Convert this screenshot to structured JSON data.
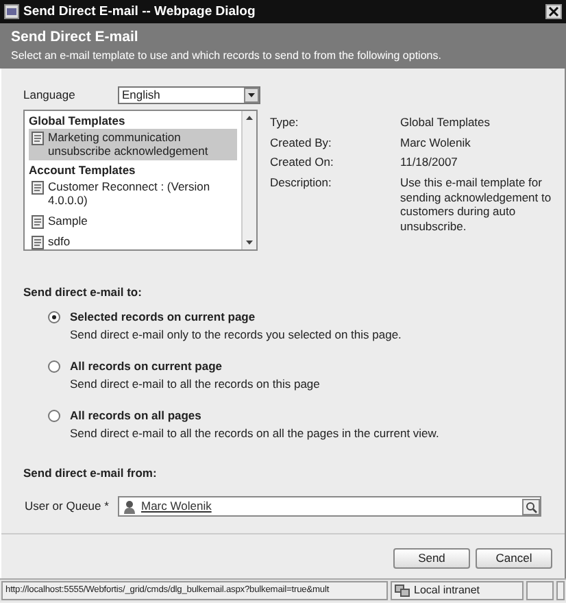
{
  "window": {
    "title": "Send Direct E-mail -- Webpage Dialog"
  },
  "header": {
    "title": "Send Direct E-mail",
    "subtitle": "Select an e-mail template to use and which records to send to from the following options."
  },
  "language": {
    "label": "Language",
    "value": "English"
  },
  "templates": {
    "groups": [
      {
        "name": "Global Templates",
        "items": [
          {
            "name": "Marketing communication unsubscribe acknowledgement",
            "selected": true
          }
        ]
      },
      {
        "name": "Account Templates",
        "items": [
          {
            "name": "Customer Reconnect : (Version 4.0.0.0)",
            "selected": false
          },
          {
            "name": "Sample",
            "selected": false
          },
          {
            "name": "sdfo",
            "selected": false
          }
        ]
      }
    ]
  },
  "details": [
    {
      "label": "Type:",
      "value": "Global Templates"
    },
    {
      "label": "Created By:",
      "value": "Marc Wolenik"
    },
    {
      "label": "Created On:",
      "value": "11/18/2007"
    },
    {
      "label": "Description:",
      "value": "Use this e-mail template for sending acknowledgement to customers during auto unsubscribe."
    }
  ],
  "send_to": {
    "heading": "Send direct e-mail to:",
    "options": [
      {
        "label": "Selected records on current page",
        "description": "Send direct e-mail only to the records you selected on this page.",
        "selected": true
      },
      {
        "label": "All records on current page",
        "description": "Send direct e-mail to all the records on this page",
        "selected": false
      },
      {
        "label": "All records on all pages",
        "description": "Send direct e-mail to all the records on all the pages in the current view.",
        "selected": false
      }
    ]
  },
  "send_from": {
    "heading": "Send direct e-mail from:",
    "field_label": "User or Queue",
    "required_mark": "*",
    "value": "Marc Wolenik"
  },
  "buttons": [
    "Send",
    "Cancel"
  ],
  "status_bar": {
    "url": "http://localhost:5555/Webfortis/_grid/cmds/dlg_bulkemail.aspx?bulkemail=true&mult",
    "zone": "Local intranet"
  }
}
